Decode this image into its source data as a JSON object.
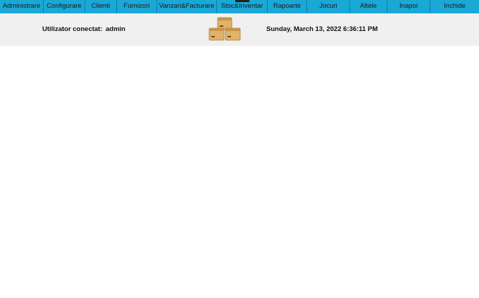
{
  "menu": {
    "items": [
      {
        "label": "Administrare"
      },
      {
        "label": "Configurare"
      },
      {
        "label": "Clienti"
      },
      {
        "label": "Furnizori"
      },
      {
        "label": "Vanzari&Facturare"
      },
      {
        "label": "Stoc&Inventar",
        "active": true
      },
      {
        "label": "Rapoarte"
      },
      {
        "label": "Jocuri"
      },
      {
        "label": "Altele"
      },
      {
        "label": "Inapoi"
      },
      {
        "label": "Inchide"
      }
    ]
  },
  "header": {
    "user_label": "Utilizator conectat:",
    "user_value": "admin",
    "datetime": "Sunday, March 13, 2022 6:36:11 PM",
    "logo_icon": "boxes-icon"
  },
  "colors": {
    "menubar": "#1aa8d6",
    "header_bg": "#f0f0f0",
    "box_fill": "#e0b36a"
  }
}
